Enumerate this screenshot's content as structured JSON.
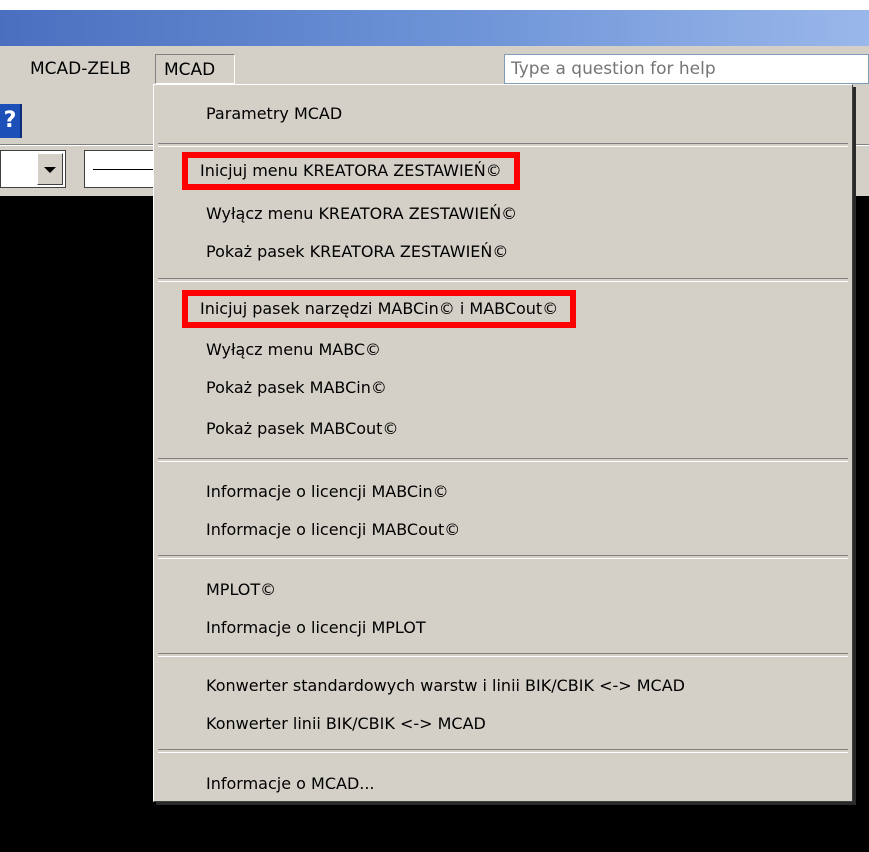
{
  "menubar": {
    "items": [
      {
        "label": "MCAD-ZELB"
      },
      {
        "label": "MCAD"
      }
    ],
    "help": {
      "placeholder": "Type a question for help"
    }
  },
  "toolbar": {
    "help_icon_glyph": "?",
    "icons": [
      "help-icon",
      "chevron-down-icon"
    ]
  },
  "mcad_menu": {
    "groups": [
      [
        {
          "label": "Parametry MCAD",
          "highlighted": false
        }
      ],
      [
        {
          "label": "Inicjuj menu KREATORA ZESTAWIEŃ©",
          "highlighted": true
        },
        {
          "label": "Wyłącz menu KREATORA ZESTAWIEŃ©",
          "highlighted": false
        },
        {
          "label": "Pokaż pasek KREATORA ZESTAWIEŃ©",
          "highlighted": false
        }
      ],
      [
        {
          "label": "Inicjuj pasek narzędzi MABCin© i MABCout©",
          "highlighted": true
        },
        {
          "label": "Wyłącz menu MABC©",
          "highlighted": false
        },
        {
          "label": "Pokaż pasek MABCin©",
          "highlighted": false
        },
        {
          "label": "Pokaż pasek MABCout©",
          "highlighted": false
        }
      ],
      [
        {
          "label": "Informacje o licencji MABCin©",
          "highlighted": false
        },
        {
          "label": "Informacje o licencji MABCout©",
          "highlighted": false
        }
      ],
      [
        {
          "label": "MPLOT©",
          "highlighted": false
        },
        {
          "label": "Informacje o licencji MPLOT",
          "highlighted": false
        }
      ],
      [
        {
          "label": "Konwerter standardowych warstw i linii BIK/CBIK <-> MCAD",
          "highlighted": false
        },
        {
          "label": "Konwerter linii BIK/CBIK <-> MCAD",
          "highlighted": false
        }
      ],
      [
        {
          "label": "Informacje o MCAD...",
          "highlighted": false
        }
      ]
    ]
  },
  "colors": {
    "highlight_border": "#ff0000",
    "menu_background": "#d4d0c8",
    "canvas": "#000000",
    "titlebar": "#6f95d8"
  }
}
